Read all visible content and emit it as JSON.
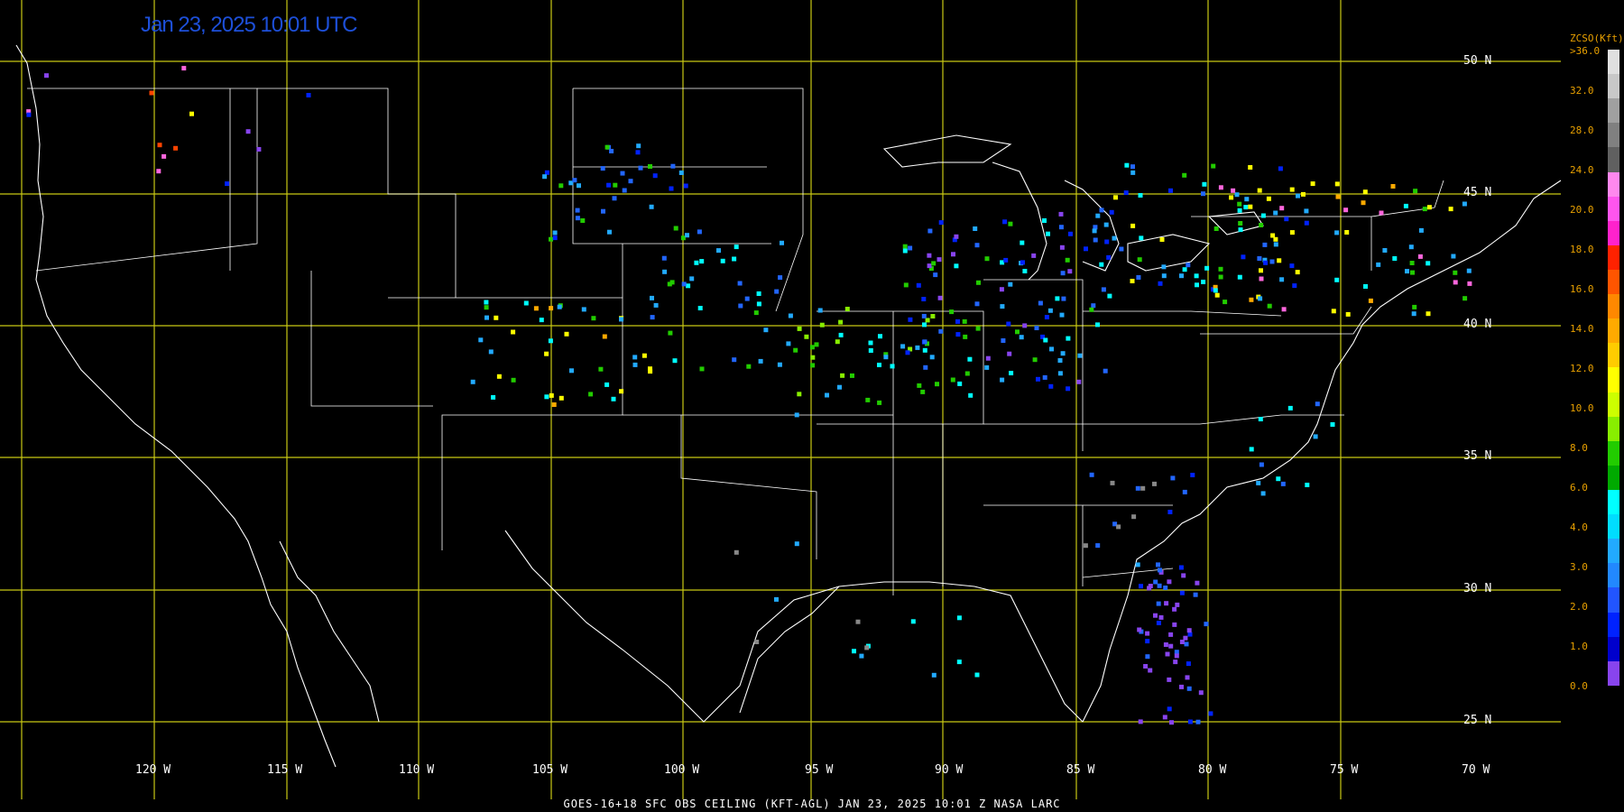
{
  "title": "Jan 23, 2025 10:01 UTC",
  "footer": "GOES-16+18  SFC OBS CEILING (KFT-AGL)   JAN 23, 2025 10:01 Z   NASA LARC",
  "lat_labels": [
    "50 N",
    "45 N",
    "40 N",
    "35 N",
    "30 N",
    "25 N"
  ],
  "lon_labels": [
    "120 W",
    "115 W",
    "110 W",
    "105 W",
    "100 W",
    "95 W",
    "90 W",
    "85 W",
    "80 W",
    "75 W",
    "70 W"
  ],
  "legend": {
    "title": "ZCSO(Kft)",
    "max_label": ">36.0",
    "ticks": [
      "32.0",
      "28.0",
      "24.0",
      "20.0",
      "18.0",
      "16.0",
      "14.0",
      "12.0",
      "10.0",
      "8.0",
      "6.0",
      "4.0",
      "3.0",
      "2.0",
      "1.0",
      "0.0"
    ],
    "colors_top_to_bottom": [
      "#e0e0e0",
      "#c8c8c8",
      "#a0a0a0",
      "#808080",
      "#606060",
      "#ff88ee",
      "#ff55ee",
      "#ff22cc",
      "#ff2200",
      "#ff5500",
      "#ff8800",
      "#ffaa00",
      "#ffcc00",
      "#ffff00",
      "#ccff00",
      "#88ee00",
      "#22cc00",
      "#00aa00",
      "#00ffff",
      "#00ddff",
      "#22aaff",
      "#2288ff",
      "#2255ff",
      "#0022ff",
      "#0000cc",
      "#8844ee"
    ]
  },
  "observation_classes": [
    "0-1",
    "1-2",
    "2-3",
    "3-4",
    "4-6",
    "6-8",
    "8-10",
    "10-12",
    "12-14",
    "16-18",
    "20-24",
    "unknown"
  ],
  "colors": {
    "background": "#000000",
    "grid": "#c8c814",
    "boundary": "#ffffff",
    "title": "#1d4fd8",
    "legend_text": "#e8a000"
  }
}
